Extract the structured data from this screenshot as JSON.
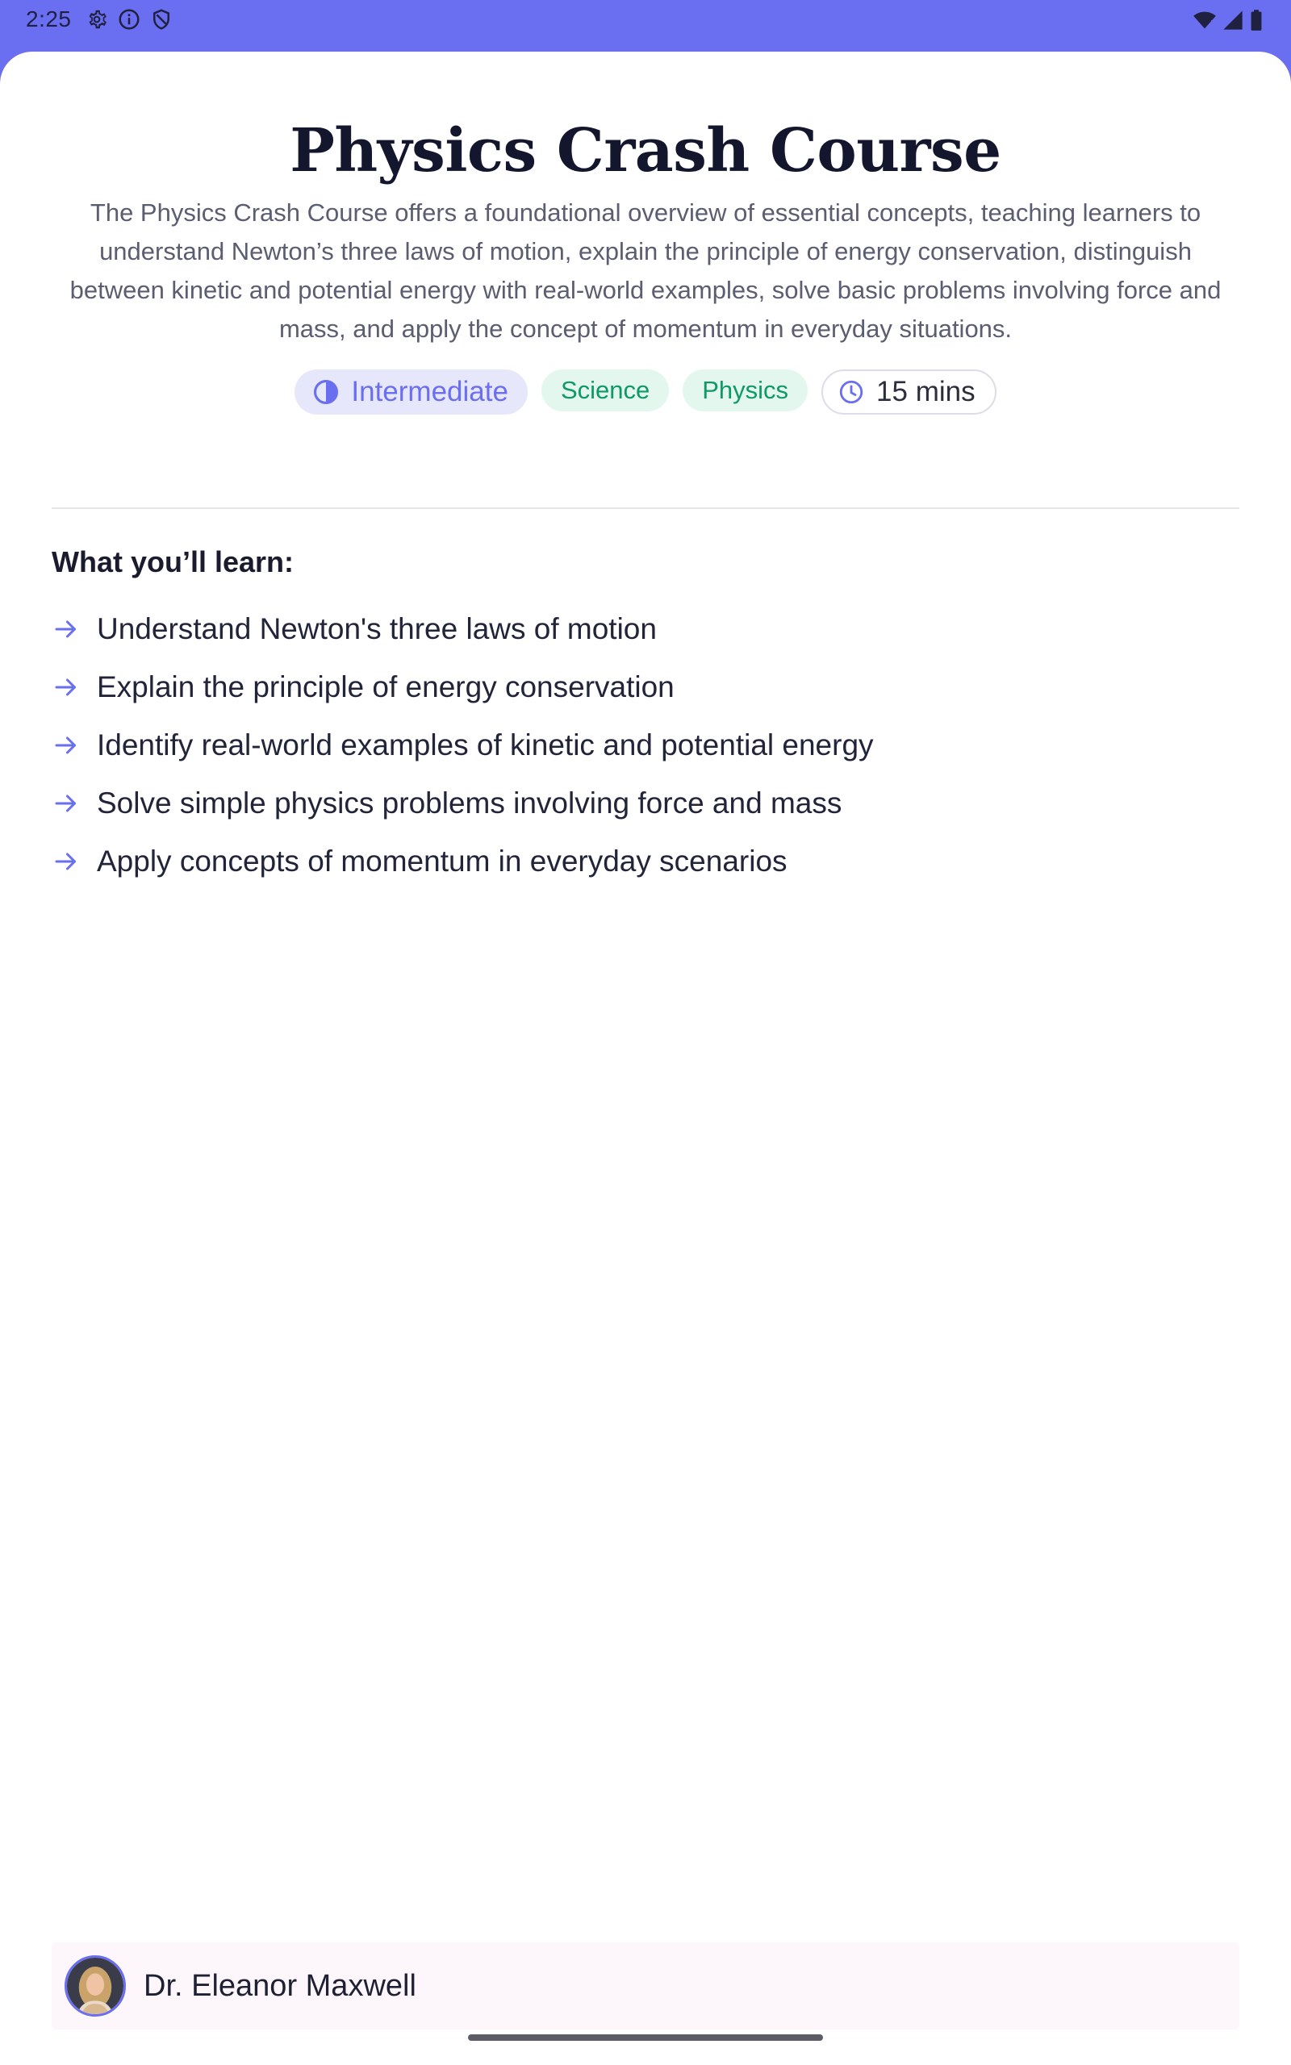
{
  "status_bar": {
    "time": "2:25",
    "icons": [
      "gear-icon",
      "info-icon",
      "shield-icon",
      "wifi-icon",
      "signal-icon",
      "battery-icon"
    ]
  },
  "course": {
    "title": "Physics Crash Course",
    "description": "The Physics Crash Course offers a foundational overview of essential concepts, teaching learners to understand Newton’s three laws of motion, explain the principle of energy conservation, distinguish between kinetic and potential energy with real-world examples, solve basic problems involving force and mass, and apply the concept of momentum in everyday situations.",
    "tags": {
      "level": "Intermediate",
      "subject": "Science",
      "topic": "Physics",
      "duration": "15 mins"
    }
  },
  "learn": {
    "heading": "What you’ll learn:",
    "items": [
      "Understand Newton's three laws of motion",
      "Explain the principle of energy conservation",
      "Identify real-world examples of kinetic and potential energy",
      "Solve simple physics problems involving force and mass",
      "Apply concepts of momentum in everyday scenarios"
    ]
  },
  "author": {
    "name": "Dr. Eleanor Maxwell"
  },
  "colors": {
    "accent": "#6a6ef0",
    "tag_green_bg": "#e3f7ef",
    "tag_green_text": "#0e9966",
    "tag_level_bg": "#e6e7fb",
    "title": "#14162e",
    "author_bar_bg": "#fdf7fb"
  }
}
